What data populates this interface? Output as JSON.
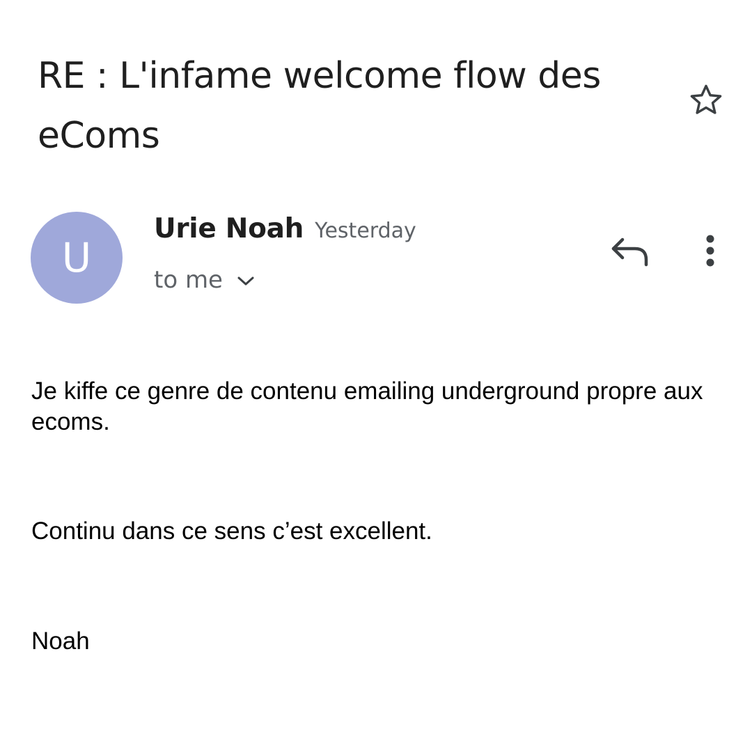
{
  "email": {
    "subject": "RE : L'infame welcome flow des eComs",
    "starred": false,
    "sender": {
      "name": "Urie Noah",
      "initial": "U",
      "avatar_color": "#9fa8da",
      "date": "Yesterday"
    },
    "recipient_label": "to me",
    "body": [
      "Je kiffe ce genre de contenu emailing underground propre aux ecoms.",
      "Continu dans ce sens c’est excellent.",
      "Noah"
    ]
  },
  "icons": {
    "star": "star-outline-icon",
    "reply": "reply-icon",
    "more": "more-vert-icon",
    "expand": "chevron-down-icon"
  }
}
